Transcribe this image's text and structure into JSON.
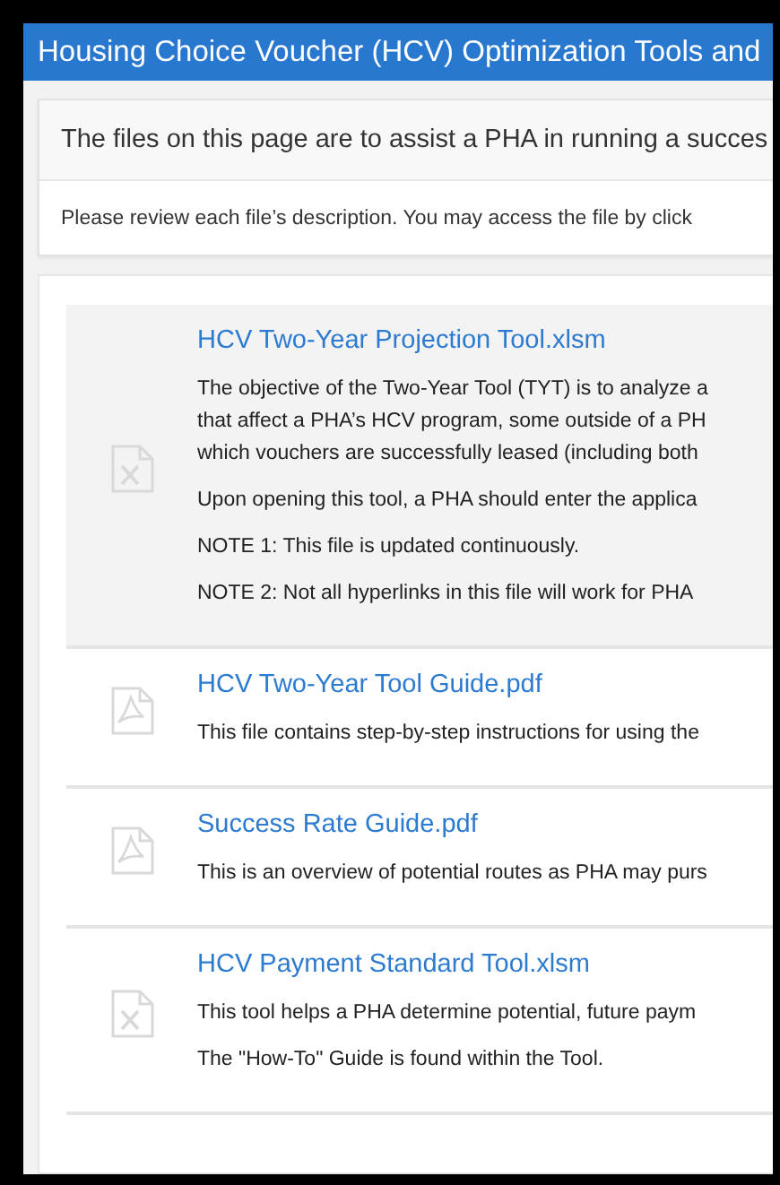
{
  "header": {
    "title": "Housing Choice Voucher (HCV) Optimization Tools and"
  },
  "intro": {
    "text": "The files on this page are to assist a PHA in running a succes"
  },
  "instructions": {
    "text": "Please review each file’s description. You may access the file by click"
  },
  "files": [
    {
      "name": "HCV Two-Year Projection Tool.xlsm",
      "kind": "spreadsheet",
      "highlighted": true,
      "paragraphs": [
        [
          "The objective of the Two-Year Tool (TYT) is to analyze a",
          "that affect a PHA’s HCV program, some outside of a PH",
          "which vouchers are successfully leased (including both"
        ],
        [
          "Upon opening this tool, a PHA should enter the applica"
        ],
        [
          "NOTE 1:  This file is updated continuously."
        ],
        [
          "NOTE 2:  Not all hyperlinks in this file will work for PHA"
        ]
      ]
    },
    {
      "name": "HCV Two-Year Tool Guide.pdf",
      "kind": "pdf",
      "highlighted": false,
      "paragraphs": [
        [
          "This file contains step-by-step instructions for using the"
        ]
      ]
    },
    {
      "name": "Success Rate Guide.pdf",
      "kind": "pdf",
      "highlighted": false,
      "paragraphs": [
        [
          "This is an overview of potential routes as PHA may purs"
        ]
      ]
    },
    {
      "name": "HCV Payment Standard Tool.xlsm",
      "kind": "spreadsheet",
      "highlighted": false,
      "paragraphs": [
        [
          "This tool helps a PHA determine potential, future paym"
        ],
        [
          "The \"How-To\" Guide is found within the Tool."
        ]
      ]
    }
  ]
}
